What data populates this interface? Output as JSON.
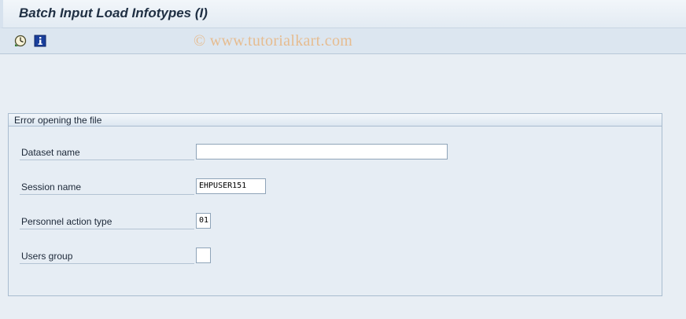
{
  "window": {
    "title": "Batch Input Load Infotypes (I)"
  },
  "toolbar": {
    "items": [
      {
        "icon": "execute-clock-icon"
      },
      {
        "icon": "info-icon"
      }
    ],
    "watermark": "© www.tutorialkart.com"
  },
  "group": {
    "title": "Error opening the file",
    "fields": [
      {
        "label": "Dataset name",
        "value": ""
      },
      {
        "label": "Session name",
        "value": "EHPUSER151"
      },
      {
        "label": "Personnel action type",
        "value": "01"
      },
      {
        "label": "Users group",
        "value": ""
      }
    ]
  },
  "colors": {
    "title_text": "#1f2f43",
    "background": "#e8eef4",
    "watermark": "#e8b278"
  }
}
